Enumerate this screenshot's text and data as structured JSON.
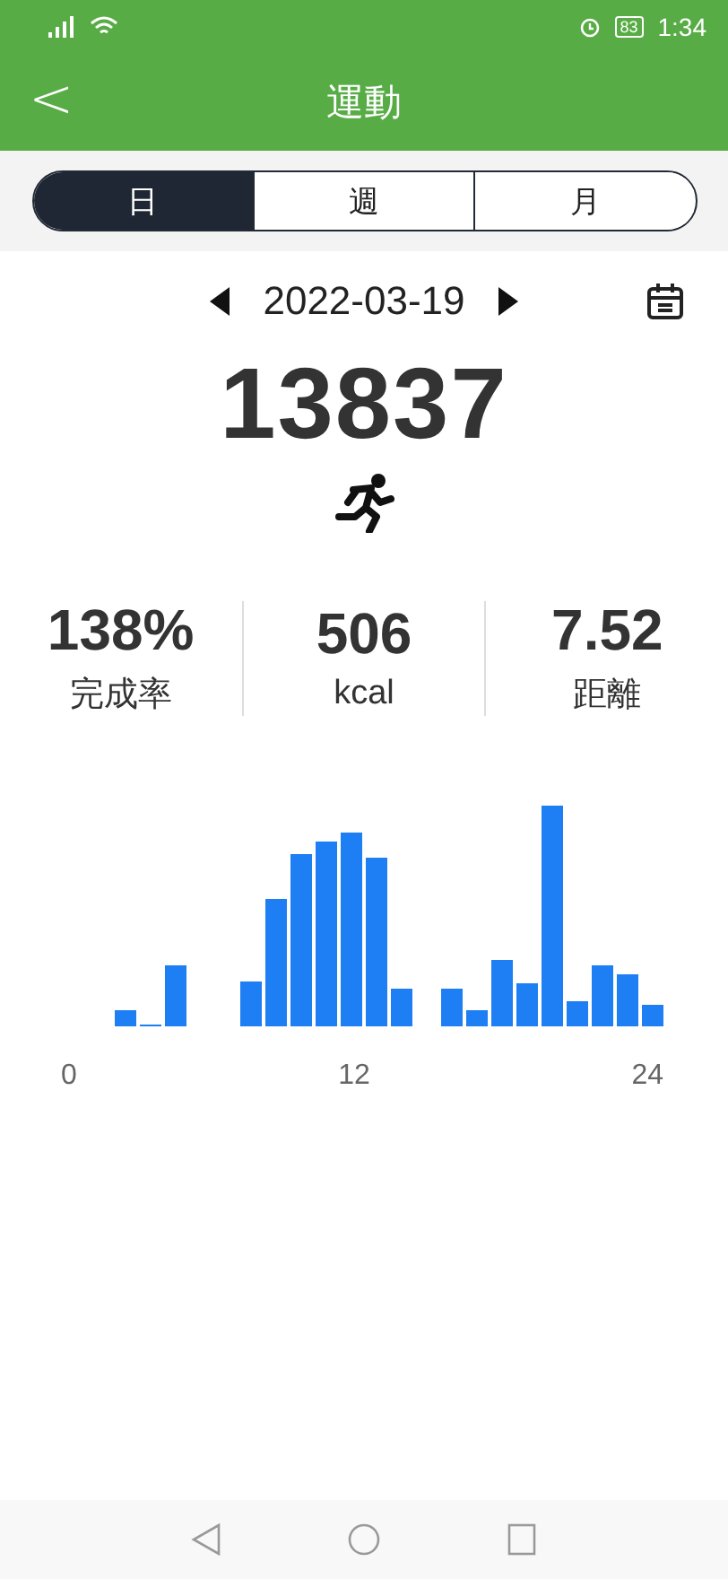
{
  "status_bar": {
    "time": "1:34",
    "battery": "83"
  },
  "header": {
    "back": "<",
    "title": "運動"
  },
  "tabs": [
    {
      "label": "日",
      "selected": true
    },
    {
      "label": "週",
      "selected": false
    },
    {
      "label": "月",
      "selected": false
    }
  ],
  "date": "2022-03-19",
  "steps": "13837",
  "stats": [
    {
      "value": "138%",
      "label": "完成率"
    },
    {
      "value": "506",
      "label": "kcal"
    },
    {
      "value": "7.52",
      "label": "距離"
    }
  ],
  "chart": {
    "axis_labels": [
      "0",
      "12",
      "24"
    ]
  }
}
